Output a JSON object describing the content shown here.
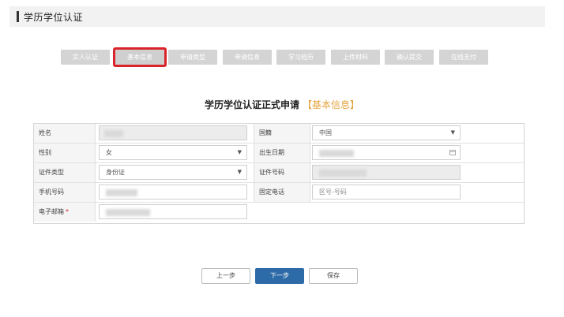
{
  "header": {
    "title": "学历学位认证"
  },
  "steps": [
    {
      "label": "实人认证",
      "active": false
    },
    {
      "label": "基本信息",
      "active": true
    },
    {
      "label": "申请类型",
      "active": false
    },
    {
      "label": "申请信息",
      "active": false
    },
    {
      "label": "学习经历",
      "active": false
    },
    {
      "label": "上传材料",
      "active": false
    },
    {
      "label": "确认提交",
      "active": false
    },
    {
      "label": "在线支付",
      "active": false
    }
  ],
  "form": {
    "title": "学历学位认证正式申请",
    "section": "【基本信息】",
    "name_label": "姓名",
    "nationality_label": "国籍",
    "nationality_value": "中国",
    "gender_label": "性别",
    "gender_value": "女",
    "birthdate_label": "出生日期",
    "id_type_label": "证件类型",
    "id_type_value": "身份证",
    "id_number_label": "证件号码",
    "phone_label": "手机号码",
    "landline_label": "固定电话",
    "landline_placeholder": "区号-号码",
    "email_label": "电子邮箱",
    "required_mark": "*"
  },
  "buttons": {
    "prev": "上一步",
    "next": "下一步",
    "save": "保存"
  },
  "colors": {
    "accent": "#d8242a",
    "primary": "#2d6aa8",
    "highlight": "#e6a23c",
    "step_bg": "#d4d4d4"
  }
}
